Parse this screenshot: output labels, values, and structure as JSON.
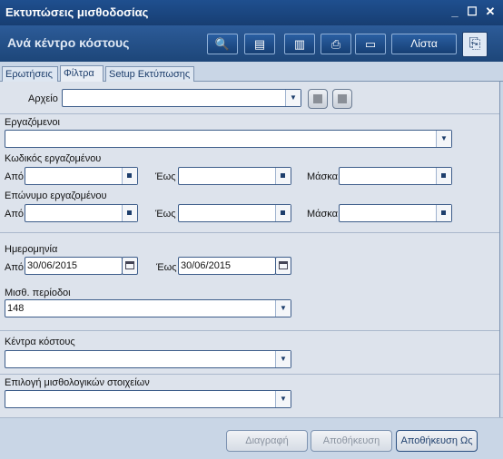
{
  "window": {
    "title": "Εκτυπώσεις μισθοδοσίας"
  },
  "header": {
    "subtitle": "Ανά κέντρο κόστους",
    "list_button": "Λίστα"
  },
  "tabs": [
    "Ερωτήσεις",
    "Φίλτρα",
    "Setup Εκτύπωσης"
  ],
  "filters": {
    "archive_label": "Αρχείο",
    "archive_value": "",
    "employees_label": "Εργαζόμενοι",
    "employees_value": "",
    "emp_code_label": "Κωδικός εργαζομένου",
    "emp_surname_label": "Επώνυμο εργαζομένου",
    "from_label": "Από",
    "to_label": "Έως",
    "mask_label": "Μάσκα",
    "date_label": "Ημερομηνία",
    "date_from": "30/06/2015",
    "date_to": "30/06/2015",
    "period_label": "Μισθ. περίοδοι",
    "period_value": "148",
    "cost_centers_label": "Κέντρα κόστους",
    "cost_centers_value": "",
    "payroll_items_label": "Επιλογή μισθολογικών στοιχείων",
    "payroll_items_value": ""
  },
  "footer": {
    "delete": "Διαγραφή",
    "save": "Αποθήκευση",
    "save_as": "Αποθήκευση Ως"
  }
}
